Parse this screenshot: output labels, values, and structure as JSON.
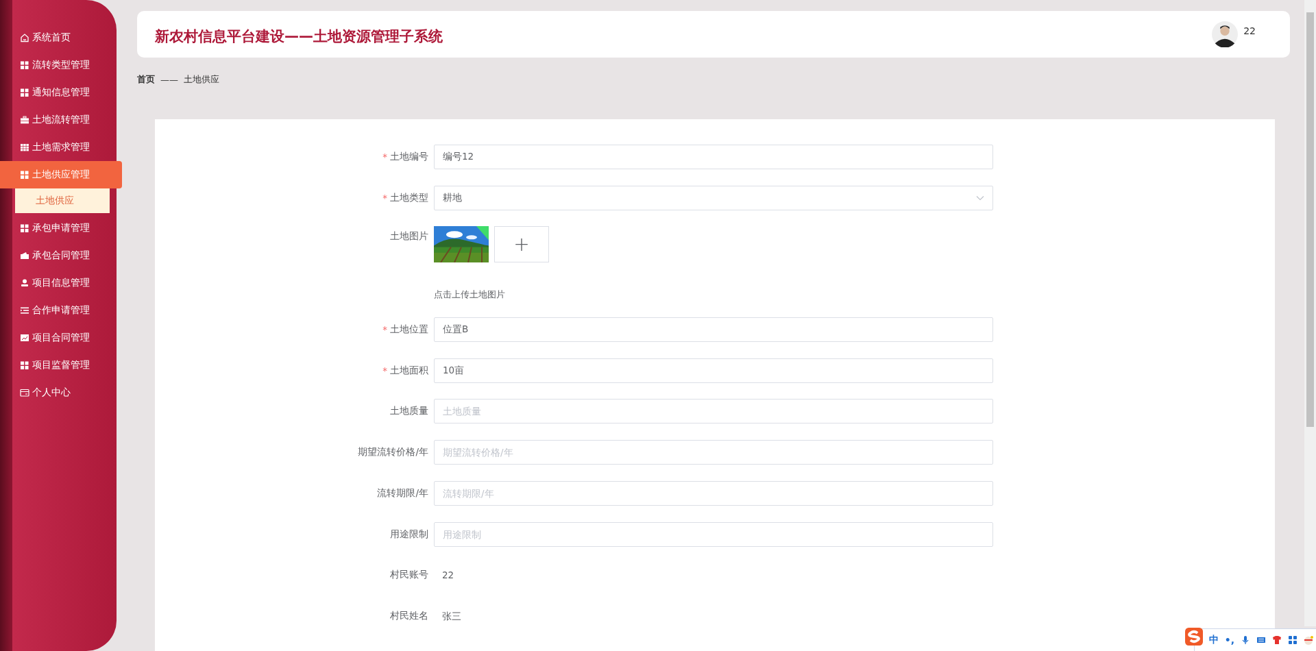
{
  "sidebar": {
    "items": [
      {
        "label": "系统首页",
        "selected": false
      },
      {
        "label": "流转类型管理",
        "selected": false
      },
      {
        "label": "通知信息管理",
        "selected": false
      },
      {
        "label": "土地流转管理",
        "selected": false
      },
      {
        "label": "土地需求管理",
        "selected": false
      },
      {
        "label": "土地供应管理",
        "selected": true,
        "expanded": true,
        "children": [
          {
            "label": "土地供应",
            "selected": true
          }
        ]
      },
      {
        "label": "承包申请管理",
        "selected": false
      },
      {
        "label": "承包合同管理",
        "selected": false
      },
      {
        "label": "项目信息管理",
        "selected": false
      },
      {
        "label": "合作申请管理",
        "selected": false
      },
      {
        "label": "项目合同管理",
        "selected": false
      },
      {
        "label": "项目监督管理",
        "selected": false
      },
      {
        "label": "个人中心",
        "selected": false
      }
    ]
  },
  "header": {
    "title": "新农村信息平台建设——土地资源管理子系统",
    "user": "22"
  },
  "breadcrumb": [
    "首页",
    "——",
    "土地供应"
  ],
  "form": {
    "required_mark": "*",
    "fields": [
      {
        "kind": "input",
        "label": "土地编号",
        "required": true,
        "value": "编号12"
      },
      {
        "kind": "select",
        "label": "土地类型",
        "required": true,
        "value": "耕地"
      },
      {
        "kind": "upload",
        "label": "土地图片",
        "required": false,
        "hint": "点击上传土地图片",
        "add": "+"
      },
      {
        "kind": "input",
        "label": "土地位置",
        "required": true,
        "value": "位置B"
      },
      {
        "kind": "input",
        "label": "土地面积",
        "required": true,
        "value": "10亩"
      },
      {
        "kind": "input",
        "label": "土地质量",
        "required": false,
        "placeholder": "土地质量"
      },
      {
        "kind": "input",
        "label": "期望流转价格/年",
        "required": false,
        "placeholder": "期望流转价格/年"
      },
      {
        "kind": "input",
        "label": "流转期限/年",
        "required": false,
        "placeholder": "流转期限/年"
      },
      {
        "kind": "input",
        "label": "用途限制",
        "required": false,
        "placeholder": "用途限制"
      },
      {
        "kind": "text",
        "label": "村民账号",
        "required": false,
        "value": "22"
      },
      {
        "kind": "text",
        "label": "村民姓名",
        "required": false,
        "value": "张三"
      }
    ]
  },
  "ime_toolbar": {
    "mode": "中",
    "punct": "•,"
  }
}
